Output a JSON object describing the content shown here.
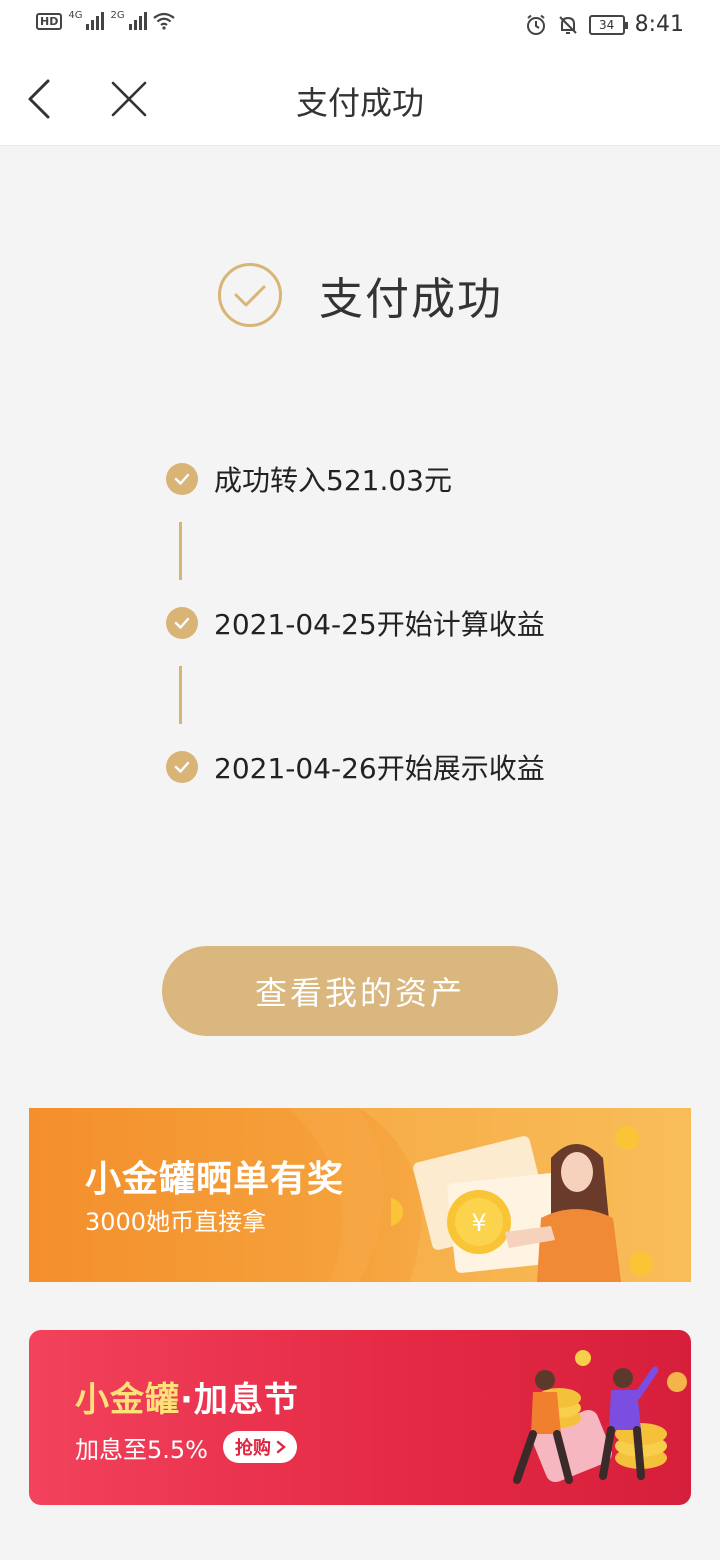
{
  "status_bar": {
    "hd_label": "HD",
    "network_1": "4G",
    "network_2": "2G",
    "battery_level": "34",
    "time": "8:41"
  },
  "nav": {
    "title": "支付成功",
    "back_icon": "chevron-left-icon",
    "close_icon": "close-icon"
  },
  "result": {
    "title": "支付成功",
    "icon": "check-circle-icon"
  },
  "steps": [
    {
      "text": "成功转入521.03元"
    },
    {
      "text": "2021-04-25开始计算收益"
    },
    {
      "text": "2021-04-26开始展示收益"
    }
  ],
  "primary_button": {
    "label": "查看我的资产"
  },
  "banner_share": {
    "title": "小金罐晒单有奖",
    "subtitle": "3000她币直接拿"
  },
  "banner_interest": {
    "title_gold": "小金罐",
    "title_dot": "·",
    "title_white": "加息节",
    "subtitle": "加息至5.5%",
    "cta": "抢购",
    "cta_icon": "chevron-right-icon"
  },
  "colors": {
    "accent_gold": "#d8b476",
    "button_gold": "#dab77e",
    "banner_orange": "#f5a23c",
    "banner_red": "#e52a45"
  }
}
